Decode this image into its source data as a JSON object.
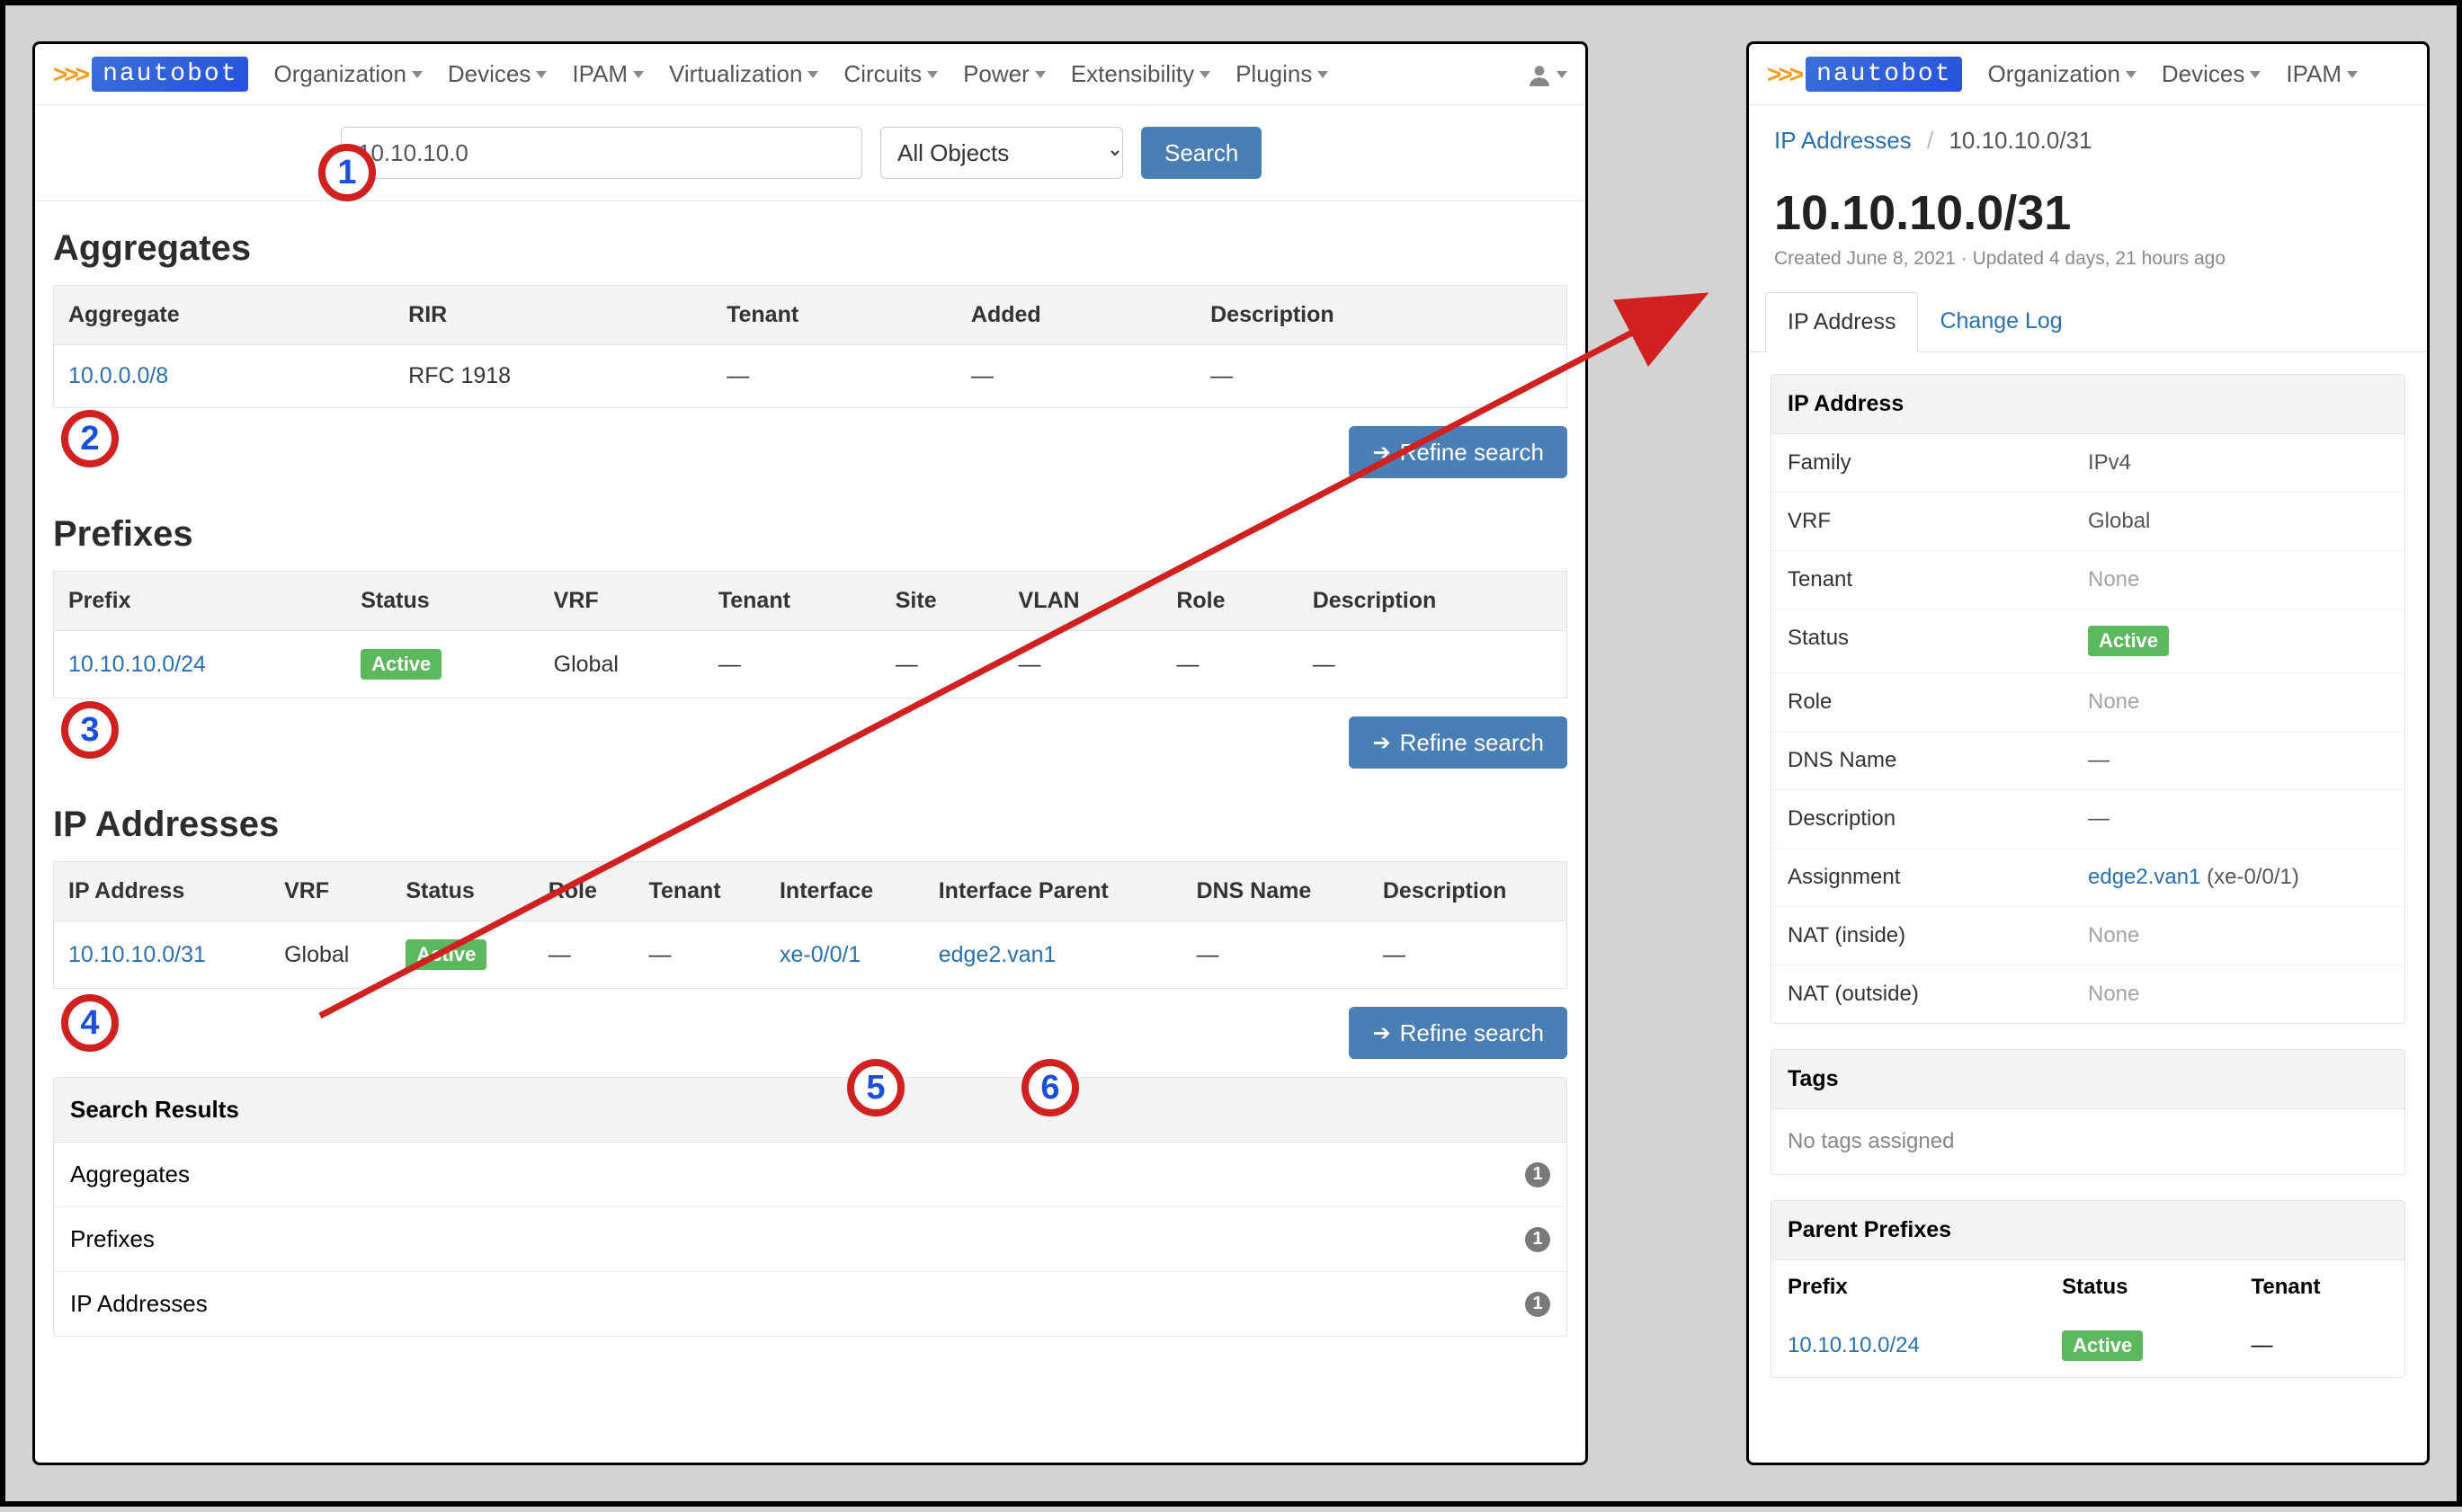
{
  "brand": {
    "name": "nautobot"
  },
  "nav": {
    "items": [
      "Organization",
      "Devices",
      "IPAM",
      "Virtualization",
      "Circuits",
      "Power",
      "Extensibility",
      "Plugins"
    ]
  },
  "search": {
    "value": "10.10.10.0",
    "filter": "All Objects",
    "button": "Search"
  },
  "sections": {
    "aggregates": {
      "title": "Aggregates",
      "cols": [
        "Aggregate",
        "RIR",
        "Tenant",
        "Added",
        "Description"
      ],
      "rows": [
        {
          "aggregate": "10.0.0.0/8",
          "rir": "RFC 1918",
          "tenant": "—",
          "added": "—",
          "description": "—"
        }
      ]
    },
    "prefixes": {
      "title": "Prefixes",
      "cols": [
        "Prefix",
        "Status",
        "VRF",
        "Tenant",
        "Site",
        "VLAN",
        "Role",
        "Description"
      ],
      "rows": [
        {
          "prefix": "10.10.10.0/24",
          "status": "Active",
          "vrf": "Global",
          "tenant": "—",
          "site": "—",
          "vlan": "—",
          "role": "—",
          "description": "—"
        }
      ]
    },
    "ips": {
      "title": "IP Addresses",
      "cols": [
        "IP Address",
        "VRF",
        "Status",
        "Role",
        "Tenant",
        "Interface",
        "Interface Parent",
        "DNS Name",
        "Description"
      ],
      "rows": [
        {
          "ip": "10.10.10.0/31",
          "vrf": "Global",
          "status": "Active",
          "role": "—",
          "tenant": "—",
          "interface": "xe-0/0/1",
          "parent": "edge2.van1",
          "dns": "—",
          "description": "—"
        }
      ]
    },
    "refine": "Refine search"
  },
  "summary": {
    "title": "Search Results",
    "rows": [
      {
        "label": "Aggregates",
        "count": "1"
      },
      {
        "label": "Prefixes",
        "count": "1"
      },
      {
        "label": "IP Addresses",
        "count": "1"
      }
    ]
  },
  "right": {
    "nav": {
      "items": [
        "Organization",
        "Devices",
        "IPAM"
      ]
    },
    "breadcrumb": {
      "parent": "IP Addresses",
      "current": "10.10.10.0/31"
    },
    "heading": "10.10.10.0/31",
    "meta": "Created June 8, 2021 · Updated 4 days, 21 hours ago",
    "tabs": {
      "active": "IP Address",
      "other": "Change Log"
    },
    "details": {
      "title": "IP Address",
      "rows": [
        {
          "k": "Family",
          "v": "IPv4"
        },
        {
          "k": "VRF",
          "v": "Global"
        },
        {
          "k": "Tenant",
          "v": "None",
          "muted": true
        },
        {
          "k": "Status",
          "v": "Active",
          "badge": true
        },
        {
          "k": "Role",
          "v": "None",
          "muted": true
        },
        {
          "k": "DNS Name",
          "v": "—"
        },
        {
          "k": "Description",
          "v": "—"
        },
        {
          "k": "Assignment",
          "link": "edge2.van1",
          "suffix": " (xe-0/0/1)"
        },
        {
          "k": "NAT (inside)",
          "v": "None",
          "muted": true
        },
        {
          "k": "NAT (outside)",
          "v": "None",
          "muted": true
        }
      ]
    },
    "tags": {
      "title": "Tags",
      "empty": "No tags assigned"
    },
    "parent_prefixes": {
      "title": "Parent Prefixes",
      "cols": [
        "Prefix",
        "Status",
        "Tenant"
      ],
      "row": {
        "prefix": "10.10.10.0/24",
        "status": "Active",
        "tenant": "—"
      }
    }
  },
  "annotations": [
    "1",
    "2",
    "3",
    "4",
    "5",
    "6"
  ]
}
